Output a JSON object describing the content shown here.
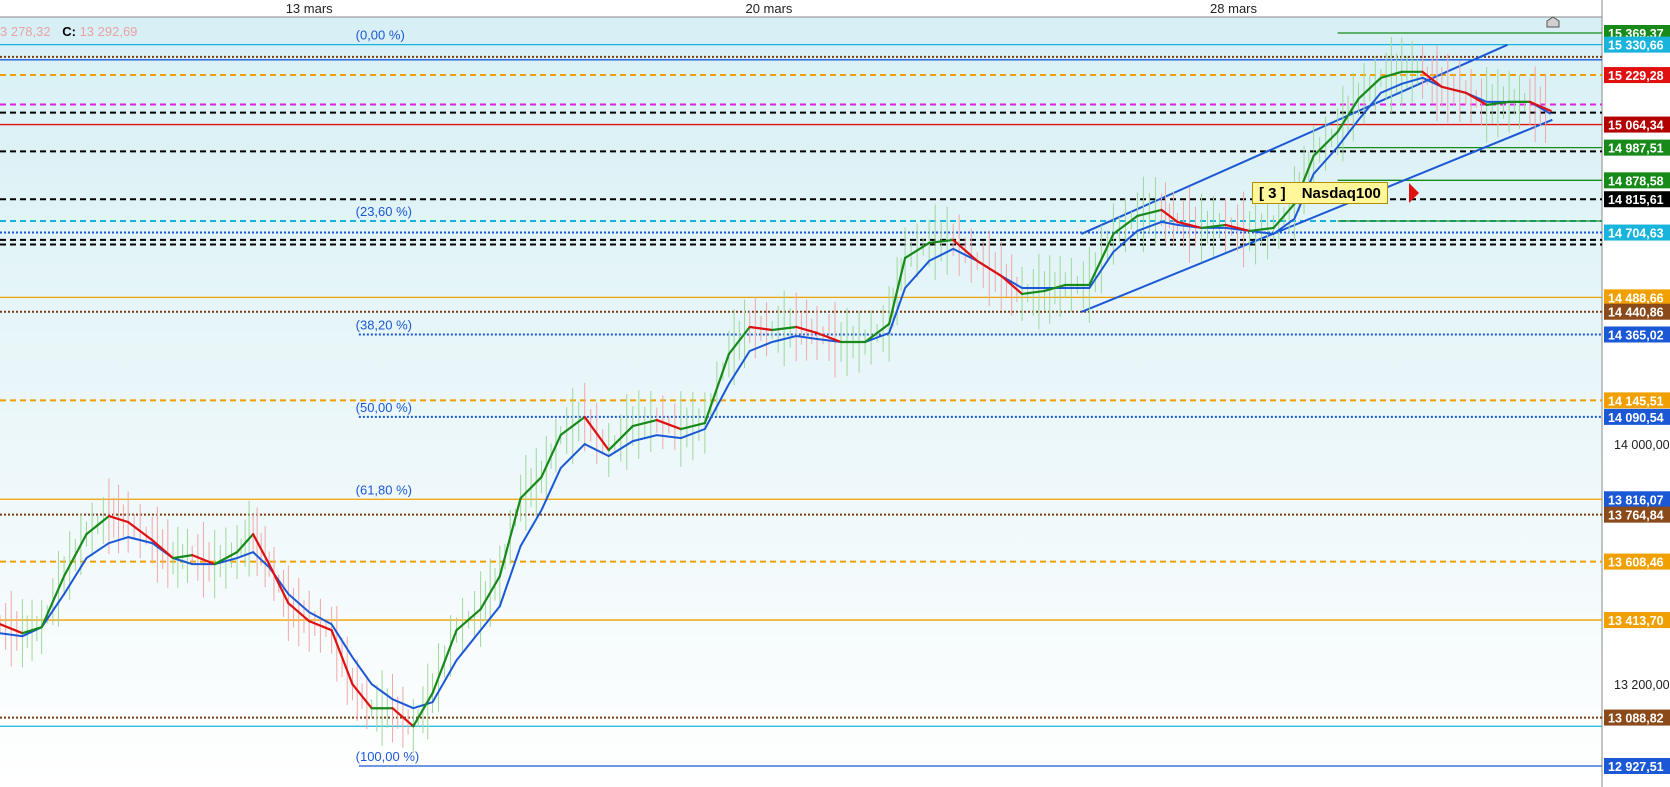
{
  "header": {
    "ohlc_prefix": "3 278,32",
    "close_label": "C:",
    "close_value": "13 292,69"
  },
  "instrument": {
    "counter": "3",
    "name": "Nasdaq100"
  },
  "colors": {
    "background_top": "#d7f0f5",
    "background_bottom": "#ffffff",
    "fast_ma_up": "#178a1a",
    "fast_ma_down": "#e01010",
    "slow_ma": "#1b58d6",
    "channel": "#1b58d6",
    "fib": "#1b58d6",
    "orange": "#f0a000",
    "tag_fill": "#fff79a",
    "tag_arrow": "#e01010"
  },
  "chart_data": {
    "type": "line",
    "title": "",
    "xlabel": "",
    "ylabel": "",
    "ylim": [
      12850,
      15430
    ],
    "x_ticks": [
      "13 mars",
      "20 mars",
      "28 mars"
    ],
    "y_ticks": [
      "14 000,00",
      "13 200,00"
    ],
    "price_labels": [
      {
        "text": "15 369,37",
        "value": 15369.37,
        "color": "#178a1a"
      },
      {
        "text": "15 330,66",
        "value": 15330.66,
        "color": "#18b4dc"
      },
      {
        "text": "15 229,28",
        "value": 15229.28,
        "color": "#e01010"
      },
      {
        "text": "15 064,34",
        "value": 15064.34,
        "color": "#b30000"
      },
      {
        "text": "14 987,51",
        "value": 14987.51,
        "color": "#178a1a"
      },
      {
        "text": "14 878,58",
        "value": 14878.58,
        "color": "#178a1a"
      },
      {
        "text": "14 815,61",
        "value": 14815.61,
        "color": "#000000"
      },
      {
        "text": "14 704,63",
        "value": 14704.63,
        "color": "#18b4dc"
      },
      {
        "text": "14 488,66",
        "value": 14488.66,
        "color": "#f0a000"
      },
      {
        "text": "14 440,86",
        "value": 14440.86,
        "color": "#8b4a1a"
      },
      {
        "text": "14 365,02",
        "value": 14365.02,
        "color": "#1b58d6"
      },
      {
        "text": "14 145,51",
        "value": 14145.51,
        "color": "#f0a000"
      },
      {
        "text": "14 090,54",
        "value": 14090.54,
        "color": "#1b58d6"
      },
      {
        "text": "13 816,07",
        "value": 13816.07,
        "color": "#1b58d6"
      },
      {
        "text": "13 764,84",
        "value": 13764.84,
        "color": "#8b4a1a"
      },
      {
        "text": "13 608,46",
        "value": 13608.46,
        "color": "#f0a000"
      },
      {
        "text": "13 413,70",
        "value": 13413.7,
        "color": "#f0a000"
      },
      {
        "text": "13 088,82",
        "value": 13088.82,
        "color": "#8b4a1a"
      },
      {
        "text": "12 927,51",
        "value": 12927.51,
        "color": "#1b58d6"
      }
    ],
    "fib_levels": [
      {
        "label": "(0,00 %)",
        "value": 15330.66
      },
      {
        "label": "(23,60 %)",
        "value": 14743
      },
      {
        "label": "(38,20 %)",
        "value": 14365.02
      },
      {
        "label": "(50,00 %)",
        "value": 14090.54
      },
      {
        "label": "(61,80 %)",
        "value": 13816.07
      },
      {
        "label": "(100,00 %)",
        "value": 12927.51
      }
    ],
    "horizontal_levels": [
      {
        "value": 15369.37,
        "style": "solid",
        "color": "#178a1a",
        "start": 0.835
      },
      {
        "value": 15330.66,
        "style": "solid",
        "color": "#18b4dc",
        "start": 0
      },
      {
        "value": 15290,
        "style": "dotted",
        "color": "#7a3d12",
        "start": 0
      },
      {
        "value": 15280,
        "style": "solid",
        "color": "#1b58d6",
        "start": 0
      },
      {
        "value": 15229.28,
        "style": "dashed",
        "color": "#f0a000",
        "start": 0
      },
      {
        "value": 15131,
        "style": "dashed",
        "color": "#e020e0",
        "start": 0
      },
      {
        "value": 15104,
        "style": "dashed",
        "color": "#000000",
        "start": 0
      },
      {
        "value": 15064.34,
        "style": "solid",
        "color": "#e01010",
        "start": 0
      },
      {
        "value": 14987.51,
        "style": "solid",
        "color": "#178a1a",
        "start": 0.835
      },
      {
        "value": 14975,
        "style": "dashed",
        "color": "#000000",
        "start": 0
      },
      {
        "value": 14878.58,
        "style": "solid",
        "color": "#178a1a",
        "start": 0.835
      },
      {
        "value": 14815.61,
        "style": "dashed",
        "color": "#000000",
        "start": 0
      },
      {
        "value": 14743,
        "style": "dashed",
        "color": "#18b4dc",
        "start": 0
      },
      {
        "value": 14743,
        "style": "solid",
        "color": "#178a1a",
        "start": 0.835
      },
      {
        "value": 14704.63,
        "style": "dotted",
        "color": "#1b58d6",
        "start": 0
      },
      {
        "value": 14680,
        "style": "dashed",
        "color": "#000000",
        "start": 0
      },
      {
        "value": 14665,
        "style": "dashed",
        "color": "#000000",
        "start": 0
      },
      {
        "value": 14488.66,
        "style": "solid",
        "color": "#f0a000",
        "start": 0
      },
      {
        "value": 14440.86,
        "style": "dotted",
        "color": "#7a3d12",
        "start": 0
      },
      {
        "value": 14365.02,
        "style": "dotted",
        "color": "#1b58d6",
        "start": 0.224
      },
      {
        "value": 14145.51,
        "style": "dashed",
        "color": "#f0a000",
        "start": 0
      },
      {
        "value": 14090.54,
        "style": "dotted",
        "color": "#1b58d6",
        "start": 0.224
      },
      {
        "value": 13816.07,
        "style": "solid",
        "color": "#f0a000",
        "start": 0
      },
      {
        "value": 13764.84,
        "style": "dotted",
        "color": "#7a3d12",
        "start": 0
      },
      {
        "value": 13608.46,
        "style": "dashed",
        "color": "#f0a000",
        "start": 0
      },
      {
        "value": 13413.7,
        "style": "solid",
        "color": "#f0a000",
        "start": 0
      },
      {
        "value": 13088.82,
        "style": "dotted",
        "color": "#7a3d12",
        "start": 0
      },
      {
        "value": 13060,
        "style": "solid",
        "color": "#18b4dc",
        "start": 0
      },
      {
        "value": 12927.51,
        "style": "solid",
        "color": "#1b58d6",
        "start": 0.224
      }
    ],
    "channel_lines": [
      {
        "from": {
          "t": 0.675,
          "p": 14700
        },
        "to": {
          "t": 0.941,
          "p": 15330
        }
      },
      {
        "from": {
          "t": 0.675,
          "p": 14440
        },
        "to": {
          "t": 0.969,
          "p": 15080
        }
      }
    ],
    "fast_ma": [
      {
        "t": 0.0,
        "p": 13400
      },
      {
        "t": 0.014,
        "p": 13370
      },
      {
        "t": 0.026,
        "p": 13390
      },
      {
        "t": 0.04,
        "p": 13560
      },
      {
        "t": 0.054,
        "p": 13700
      },
      {
        "t": 0.068,
        "p": 13760
      },
      {
        "t": 0.08,
        "p": 13740
      },
      {
        "t": 0.095,
        "p": 13680
      },
      {
        "t": 0.108,
        "p": 13620
      },
      {
        "t": 0.12,
        "p": 13630
      },
      {
        "t": 0.134,
        "p": 13600
      },
      {
        "t": 0.148,
        "p": 13640
      },
      {
        "t": 0.158,
        "p": 13700
      },
      {
        "t": 0.168,
        "p": 13600
      },
      {
        "t": 0.18,
        "p": 13470
      },
      {
        "t": 0.193,
        "p": 13410
      },
      {
        "t": 0.207,
        "p": 13380
      },
      {
        "t": 0.22,
        "p": 13200
      },
      {
        "t": 0.232,
        "p": 13120
      },
      {
        "t": 0.245,
        "p": 13120
      },
      {
        "t": 0.258,
        "p": 13060
      },
      {
        "t": 0.27,
        "p": 13170
      },
      {
        "t": 0.285,
        "p": 13380
      },
      {
        "t": 0.3,
        "p": 13450
      },
      {
        "t": 0.312,
        "p": 13560
      },
      {
        "t": 0.325,
        "p": 13820
      },
      {
        "t": 0.338,
        "p": 13890
      },
      {
        "t": 0.35,
        "p": 14030
      },
      {
        "t": 0.365,
        "p": 14090
      },
      {
        "t": 0.38,
        "p": 13980
      },
      {
        "t": 0.395,
        "p": 14060
      },
      {
        "t": 0.41,
        "p": 14080
      },
      {
        "t": 0.425,
        "p": 14050
      },
      {
        "t": 0.44,
        "p": 14070
      },
      {
        "t": 0.455,
        "p": 14300
      },
      {
        "t": 0.468,
        "p": 14390
      },
      {
        "t": 0.482,
        "p": 14380
      },
      {
        "t": 0.497,
        "p": 14390
      },
      {
        "t": 0.51,
        "p": 14370
      },
      {
        "t": 0.525,
        "p": 14340
      },
      {
        "t": 0.54,
        "p": 14340
      },
      {
        "t": 0.555,
        "p": 14400
      },
      {
        "t": 0.565,
        "p": 14620
      },
      {
        "t": 0.58,
        "p": 14670
      },
      {
        "t": 0.595,
        "p": 14680
      },
      {
        "t": 0.61,
        "p": 14610
      },
      {
        "t": 0.625,
        "p": 14560
      },
      {
        "t": 0.638,
        "p": 14500
      },
      {
        "t": 0.652,
        "p": 14510
      },
      {
        "t": 0.665,
        "p": 14530
      },
      {
        "t": 0.68,
        "p": 14530
      },
      {
        "t": 0.695,
        "p": 14700
      },
      {
        "t": 0.71,
        "p": 14760
      },
      {
        "t": 0.725,
        "p": 14780
      },
      {
        "t": 0.735,
        "p": 14740
      },
      {
        "t": 0.75,
        "p": 14720
      },
      {
        "t": 0.765,
        "p": 14730
      },
      {
        "t": 0.78,
        "p": 14710
      },
      {
        "t": 0.795,
        "p": 14720
      },
      {
        "t": 0.808,
        "p": 14800
      },
      {
        "t": 0.82,
        "p": 14960
      },
      {
        "t": 0.835,
        "p": 15040
      },
      {
        "t": 0.848,
        "p": 15150
      },
      {
        "t": 0.862,
        "p": 15220
      },
      {
        "t": 0.875,
        "p": 15240
      },
      {
        "t": 0.888,
        "p": 15240
      },
      {
        "t": 0.9,
        "p": 15190
      },
      {
        "t": 0.915,
        "p": 15170
      },
      {
        "t": 0.928,
        "p": 15130
      },
      {
        "t": 0.942,
        "p": 15140
      },
      {
        "t": 0.955,
        "p": 15140
      },
      {
        "t": 0.968,
        "p": 15110
      }
    ],
    "slow_ma": [
      {
        "t": 0.0,
        "p": 13370
      },
      {
        "t": 0.014,
        "p": 13360
      },
      {
        "t": 0.026,
        "p": 13390
      },
      {
        "t": 0.04,
        "p": 13500
      },
      {
        "t": 0.054,
        "p": 13620
      },
      {
        "t": 0.068,
        "p": 13670
      },
      {
        "t": 0.08,
        "p": 13690
      },
      {
        "t": 0.095,
        "p": 13670
      },
      {
        "t": 0.108,
        "p": 13620
      },
      {
        "t": 0.12,
        "p": 13600
      },
      {
        "t": 0.134,
        "p": 13600
      },
      {
        "t": 0.148,
        "p": 13620
      },
      {
        "t": 0.158,
        "p": 13640
      },
      {
        "t": 0.168,
        "p": 13590
      },
      {
        "t": 0.18,
        "p": 13500
      },
      {
        "t": 0.193,
        "p": 13440
      },
      {
        "t": 0.207,
        "p": 13400
      },
      {
        "t": 0.22,
        "p": 13290
      },
      {
        "t": 0.232,
        "p": 13200
      },
      {
        "t": 0.245,
        "p": 13150
      },
      {
        "t": 0.258,
        "p": 13120
      },
      {
        "t": 0.27,
        "p": 13140
      },
      {
        "t": 0.285,
        "p": 13280
      },
      {
        "t": 0.3,
        "p": 13380
      },
      {
        "t": 0.312,
        "p": 13460
      },
      {
        "t": 0.325,
        "p": 13660
      },
      {
        "t": 0.338,
        "p": 13780
      },
      {
        "t": 0.35,
        "p": 13920
      },
      {
        "t": 0.365,
        "p": 14000
      },
      {
        "t": 0.38,
        "p": 13960
      },
      {
        "t": 0.395,
        "p": 14010
      },
      {
        "t": 0.41,
        "p": 14030
      },
      {
        "t": 0.425,
        "p": 14020
      },
      {
        "t": 0.44,
        "p": 14050
      },
      {
        "t": 0.455,
        "p": 14200
      },
      {
        "t": 0.468,
        "p": 14310
      },
      {
        "t": 0.482,
        "p": 14340
      },
      {
        "t": 0.497,
        "p": 14360
      },
      {
        "t": 0.51,
        "p": 14350
      },
      {
        "t": 0.525,
        "p": 14340
      },
      {
        "t": 0.54,
        "p": 14340
      },
      {
        "t": 0.555,
        "p": 14370
      },
      {
        "t": 0.565,
        "p": 14520
      },
      {
        "t": 0.58,
        "p": 14610
      },
      {
        "t": 0.595,
        "p": 14650
      },
      {
        "t": 0.61,
        "p": 14610
      },
      {
        "t": 0.625,
        "p": 14560
      },
      {
        "t": 0.638,
        "p": 14520
      },
      {
        "t": 0.652,
        "p": 14520
      },
      {
        "t": 0.665,
        "p": 14520
      },
      {
        "t": 0.68,
        "p": 14520
      },
      {
        "t": 0.695,
        "p": 14640
      },
      {
        "t": 0.71,
        "p": 14710
      },
      {
        "t": 0.725,
        "p": 14740
      },
      {
        "t": 0.735,
        "p": 14730
      },
      {
        "t": 0.75,
        "p": 14720
      },
      {
        "t": 0.765,
        "p": 14720
      },
      {
        "t": 0.78,
        "p": 14710
      },
      {
        "t": 0.795,
        "p": 14700
      },
      {
        "t": 0.808,
        "p": 14750
      },
      {
        "t": 0.82,
        "p": 14900
      },
      {
        "t": 0.835,
        "p": 14990
      },
      {
        "t": 0.848,
        "p": 15080
      },
      {
        "t": 0.862,
        "p": 15170
      },
      {
        "t": 0.875,
        "p": 15200
      },
      {
        "t": 0.888,
        "p": 15220
      },
      {
        "t": 0.9,
        "p": 15190
      },
      {
        "t": 0.915,
        "p": 15170
      },
      {
        "t": 0.928,
        "p": 15140
      },
      {
        "t": 0.942,
        "p": 15140
      },
      {
        "t": 0.955,
        "p": 15140
      },
      {
        "t": 0.968,
        "p": 15100
      }
    ]
  }
}
